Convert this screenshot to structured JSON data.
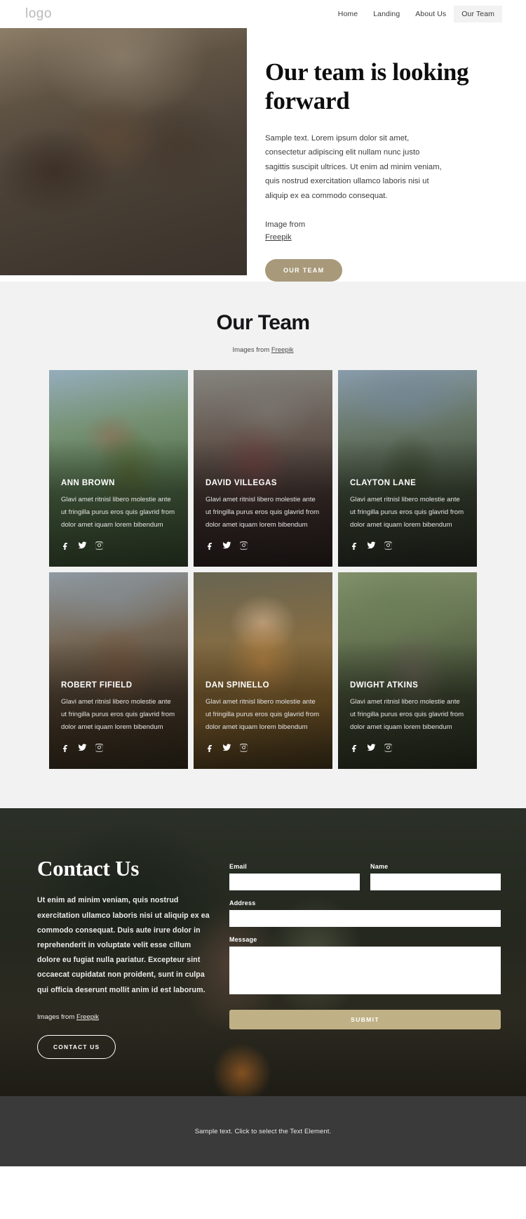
{
  "header": {
    "logo": "logo",
    "nav": [
      {
        "label": "Home",
        "active": false
      },
      {
        "label": "Landing",
        "active": false
      },
      {
        "label": "About Us",
        "active": false
      },
      {
        "label": "Our Team",
        "active": true
      }
    ]
  },
  "hero": {
    "title": "Our team is looking forward",
    "body": "Sample text. Lorem ipsum dolor sit amet, consectetur adipiscing elit nullam nunc justo sagittis suscipit ultrices. Ut enim ad minim veniam, quis nostrud exercitation ullamco laboris nisi ut aliquip ex ea commodo consequat.",
    "credit_label": "Image from",
    "credit_link": "Freepik",
    "cta_label": "OUR TEAM"
  },
  "team": {
    "heading": "Our Team",
    "subtitle_prefix": "Images from ",
    "subtitle_link": "Freepik",
    "member_desc": "Glavi amet ritnisl libero molestie ante ut fringilla purus eros quis glavrid from dolor amet iquam lorem bibendum",
    "social": [
      "facebook-icon",
      "twitter-icon",
      "instagram-icon"
    ],
    "members": [
      {
        "name": "ANN BROWN"
      },
      {
        "name": "DAVID VILLEGAS"
      },
      {
        "name": "CLAYTON LANE"
      },
      {
        "name": "ROBERT FIFIELD"
      },
      {
        "name": "DAN SPINELLO"
      },
      {
        "name": "DWIGHT ATKINS"
      }
    ]
  },
  "contact": {
    "title": "Contact Us",
    "body": "Ut enim ad minim veniam, quis nostrud exercitation ullamco laboris nisi ut aliquip ex ea commodo consequat. Duis aute irure dolor in reprehenderit in voluptate velit esse cillum dolore eu fugiat nulla pariatur. Excepteur sint occaecat cupidatat non proident, sunt in culpa qui officia deserunt mollit anim id est laborum.",
    "credit_prefix": "Images from ",
    "credit_link": "Freepik",
    "cta_label": "CONTACT US",
    "form": {
      "email_label": "Email",
      "email_value": "",
      "name_label": "Name",
      "name_value": "",
      "address_label": "Address",
      "address_value": "",
      "message_label": "Message",
      "message_value": "",
      "submit_label": "SUBMIT"
    }
  },
  "footer": {
    "text": "Sample text. Click to select the Text Element."
  },
  "colors": {
    "accent": "#a8997a",
    "submit": "#bfb185",
    "section_bg": "#f2f2f2",
    "footer_bg": "#3a3a3a"
  }
}
